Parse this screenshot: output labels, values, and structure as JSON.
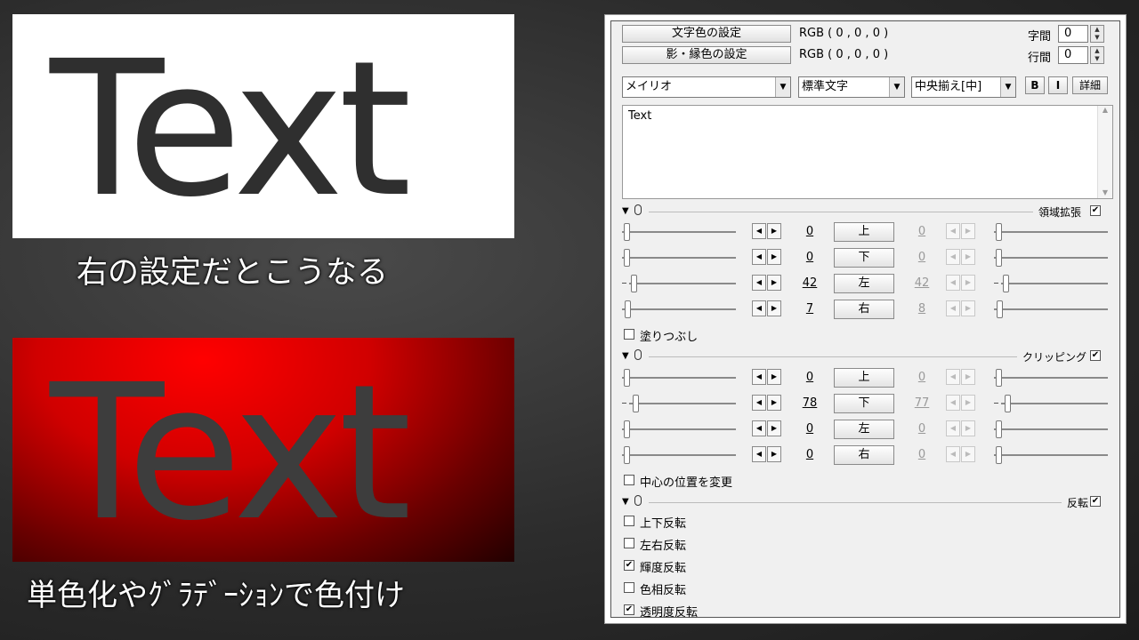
{
  "previews": {
    "top": {
      "text": "Text",
      "caption": "右の設定だとこうなる"
    },
    "bottom": {
      "text": "Text",
      "caption": "単色化やｸﾞﾗﾃﾞｰｼｮﾝで色付け"
    }
  },
  "panel": {
    "text_color_button": "文字色の設定",
    "text_color_value": "RGB ( 0 , 0 , 0 )",
    "shadow_color_button": "影・縁色の設定",
    "shadow_color_value": "RGB ( 0 , 0 , 0 )",
    "char_spacing_label": "字間",
    "char_spacing_value": "0",
    "line_spacing_label": "行間",
    "line_spacing_value": "0",
    "font_select": "メイリオ",
    "style_select": "標準文字",
    "align_select": "中央揃え[中]",
    "bold_label": "B",
    "italic_label": "I",
    "detail_label": "詳細",
    "text_content": "Text",
    "sections": {
      "expand": {
        "label": "領域拡張",
        "checked": true,
        "rows": [
          {
            "dir": "上",
            "left": "0",
            "right": "0"
          },
          {
            "dir": "下",
            "left": "0",
            "right": "0"
          },
          {
            "dir": "左",
            "left": "42",
            "right": "42"
          },
          {
            "dir": "右",
            "left": "7",
            "right": "8"
          }
        ],
        "fill_label": "塗りつぶし",
        "fill_checked": false
      },
      "clip": {
        "label": "クリッピング",
        "checked": true,
        "rows": [
          {
            "dir": "上",
            "left": "0",
            "right": "0"
          },
          {
            "dir": "下",
            "left": "78",
            "right": "77"
          },
          {
            "dir": "左",
            "left": "0",
            "right": "0"
          },
          {
            "dir": "右",
            "left": "0",
            "right": "0"
          }
        ],
        "center_label": "中心の位置を変更",
        "center_checked": false
      },
      "flip": {
        "label": "反転",
        "checked": true,
        "options": [
          {
            "label": "上下反転",
            "checked": false
          },
          {
            "label": "左右反転",
            "checked": false
          },
          {
            "label": "輝度反転",
            "checked": true
          },
          {
            "label": "色相反転",
            "checked": false
          },
          {
            "label": "透明度反転",
            "checked": true
          }
        ]
      }
    }
  }
}
